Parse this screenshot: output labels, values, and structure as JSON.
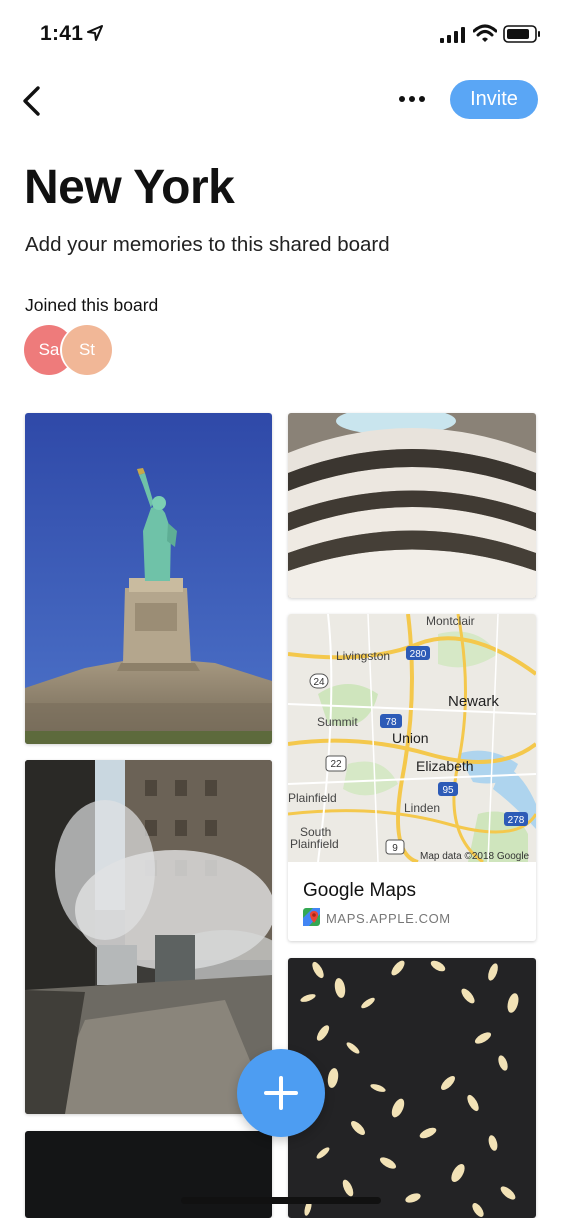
{
  "status_bar": {
    "time": "1:41"
  },
  "nav": {
    "invite_label": "Invite"
  },
  "board": {
    "title": "New York",
    "subtitle": "Add your memories to this shared board",
    "joined_label": "Joined this board",
    "members": [
      {
        "initials": "Sa",
        "color": "#ee7b7b"
      },
      {
        "initials": "St",
        "color": "#f1b797"
      }
    ]
  },
  "cards": {
    "maps": {
      "title": "Google Maps",
      "domain": "MAPS.APPLE.COM",
      "map_labels": [
        "Montclair",
        "Livingston",
        "Newark",
        "Summit",
        "Union",
        "Elizabeth",
        "Plainfield",
        "Linden",
        "South Plainfield"
      ],
      "highway_shields": [
        "280",
        "24",
        "78",
        "22",
        "95",
        "278",
        "9"
      ],
      "attribution": "Map data ©2018 Google"
    }
  },
  "colors": {
    "accent": "#5aa6f5",
    "fab": "#4d9df2"
  }
}
